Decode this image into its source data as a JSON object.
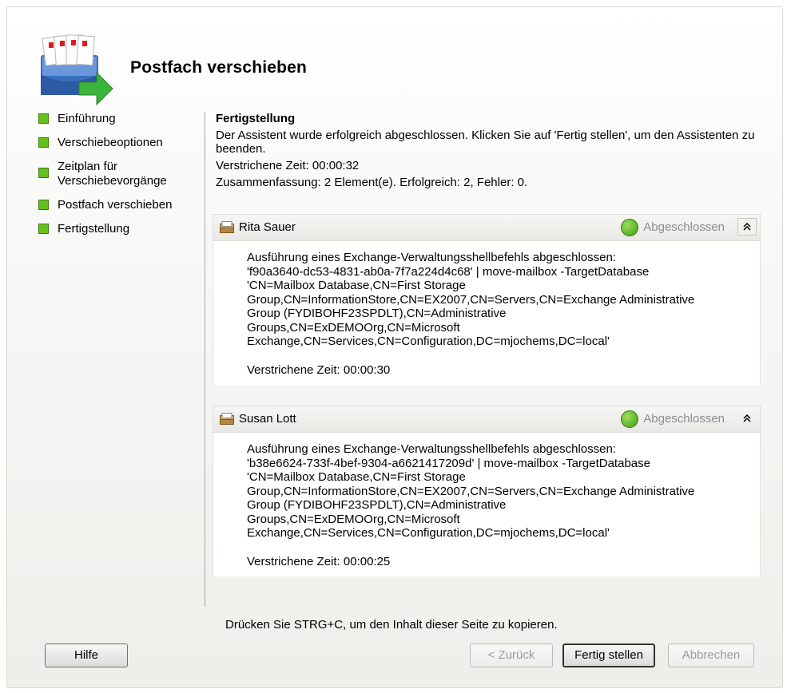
{
  "window": {
    "title": "Postfach verschieben"
  },
  "steps": [
    {
      "label": "Einführung"
    },
    {
      "label": "Verschiebeoptionen"
    },
    {
      "label": "Zeitplan für Verschiebevorgänge"
    },
    {
      "label": "Postfach verschieben"
    },
    {
      "label": "Fertigstellung"
    }
  ],
  "main": {
    "section_title": "Fertigstellung",
    "intro": "Der Assistent wurde erfolgreich abgeschlossen. Klicken Sie auf 'Fertig stellen', um den Assistenten zu beenden.",
    "elapsed": "Verstrichene Zeit: 00:00:32",
    "summary": "Zusammenfassung: 2 Element(e). Erfolgreich: 2, Fehler: 0."
  },
  "results": [
    {
      "name": "Rita Sauer",
      "status": "Abgeschlossen",
      "collapse_glyph": "≈",
      "lines": [
        "Ausführung eines Exchange-Verwaltungsshellbefehls abgeschlossen:",
        "'f90a3640-dc53-4831-ab0a-7f7a224d4c68' | move-mailbox -TargetDatabase",
        "'CN=Mailbox Database,CN=First Storage",
        "Group,CN=InformationStore,CN=EX2007,CN=Servers,CN=Exchange Administrative",
        "Group (FYDIBOHF23SPDLT),CN=Administrative",
        "Groups,CN=ExDEMOOrg,CN=Microsoft",
        "Exchange,CN=Services,CN=Configuration,DC=mjochems,DC=local'"
      ],
      "elapsed": "Verstrichene Zeit: 00:00:30"
    },
    {
      "name": "Susan Lott",
      "status": "Abgeschlossen",
      "collapse_glyph": "≈",
      "lines": [
        "Ausführung eines Exchange-Verwaltungsshellbefehls abgeschlossen:",
        "'b38e6624-733f-4bef-9304-a6621417209d' | move-mailbox -TargetDatabase",
        "'CN=Mailbox Database,CN=First Storage",
        "Group,CN=InformationStore,CN=EX2007,CN=Servers,CN=Exchange Administrative",
        "Group (FYDIBOHF23SPDLT),CN=Administrative",
        "Groups,CN=ExDEMOOrg,CN=Microsoft",
        "Exchange,CN=Services,CN=Configuration,DC=mjochems,DC=local'"
      ],
      "elapsed": "Verstrichene Zeit: 00:00:25"
    }
  ],
  "hint": "Drücken Sie STRG+C, um den Inhalt dieser Seite zu kopieren.",
  "buttons": {
    "help": "Hilfe",
    "back": "< Zurück",
    "finish": "Fertig stellen",
    "cancel": "Abbrechen"
  },
  "colors": {
    "step_bullet": "#66c01b",
    "status_text": "#8d8d8d"
  }
}
